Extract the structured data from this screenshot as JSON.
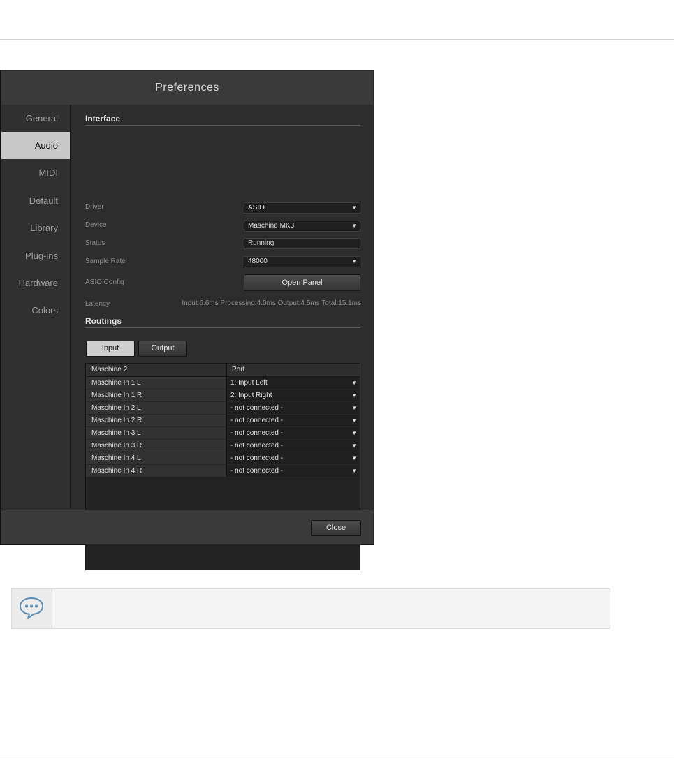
{
  "dialog": {
    "title": "Preferences",
    "sidebar": [
      "General",
      "Audio",
      "MIDI",
      "Default",
      "Library",
      "Plug-ins",
      "Hardware",
      "Colors"
    ],
    "active_item": "Audio",
    "interface": {
      "heading": "Interface",
      "driver_label": "Driver",
      "driver_value": "ASIO",
      "device_label": "Device",
      "device_value": "Maschine MK3",
      "status_label": "Status",
      "status_value": "Running",
      "sample_rate_label": "Sample Rate",
      "sample_rate_value": "48000",
      "asio_config_label": "ASIO Config",
      "open_panel_label": "Open Panel",
      "latency_label": "Latency",
      "latency_value": "Input:6.6ms  Processing:4.0ms  Output:4.5ms  Total:15.1ms"
    },
    "routings": {
      "heading": "Routings",
      "tab_input": "Input",
      "tab_output": "Output",
      "col_source": "Maschine 2",
      "col_port": "Port",
      "rows": [
        {
          "name": "Maschine In 1 L",
          "port": "1: Input Left"
        },
        {
          "name": "Maschine In 1 R",
          "port": "2: Input Right"
        },
        {
          "name": "Maschine In 2 L",
          "port": "- not connected -"
        },
        {
          "name": "Maschine In 2 R",
          "port": "- not connected -"
        },
        {
          "name": "Maschine In 3 L",
          "port": "- not connected -"
        },
        {
          "name": "Maschine In 3 R",
          "port": "- not connected -"
        },
        {
          "name": "Maschine In 4 L",
          "port": "- not connected -"
        },
        {
          "name": "Maschine In 4 R",
          "port": "- not connected -"
        }
      ]
    },
    "close_label": "Close"
  },
  "note": {
    "icon": "speech-bubble-icon",
    "text": ""
  },
  "colors": {
    "dialog_bg": "#2b2b2b",
    "active_nav": "#c8c8c8",
    "note_icon": "#5b8db5"
  }
}
